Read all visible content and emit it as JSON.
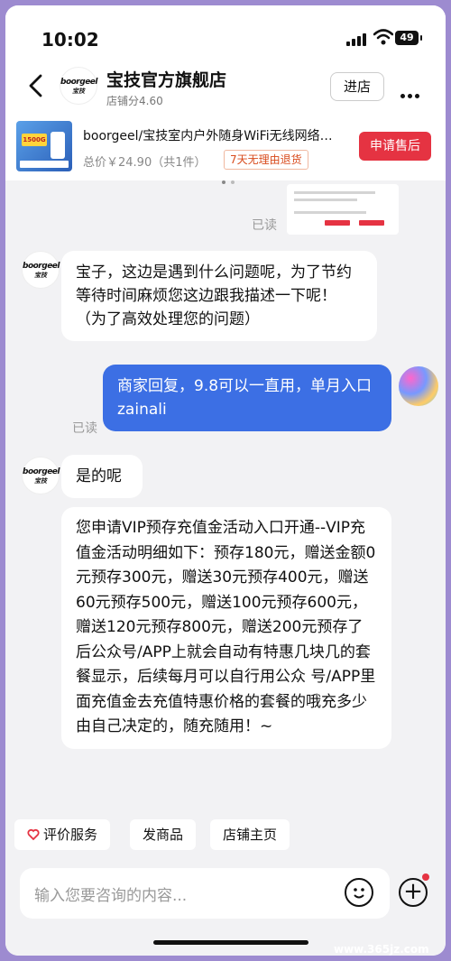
{
  "status": {
    "time": "10:02",
    "battery": "49"
  },
  "header": {
    "store_name": "宝技官方旗舰店",
    "store_score": "店铺分4.60",
    "enter_label": "进店",
    "logo_text": "boorgeel",
    "logo_sub": "宝技"
  },
  "product": {
    "title": "boorgeel/宝技室内户外随身WiFi无线网络…",
    "price": "总价￥24.90（共1件）",
    "tag": "7天无理由退货",
    "aftersale_label": "申请售后",
    "thumb_badge": "1500G"
  },
  "chat": {
    "read_label": "已读",
    "messages": [
      {
        "from": "shop",
        "text": "宝子，这边是遇到什么问题呢，为了节约等待时间麻烦您这边跟我描述一下呢！（为了高效处理您的问题）"
      },
      {
        "from": "me",
        "text": "商家回复，9.8可以一直用，单月入口zainali"
      },
      {
        "from": "shop",
        "text": "是的呢"
      },
      {
        "from": "shop",
        "text": "您申请VIP预存充值金活动入口开通--VIP充值金活动明细如下：预存180元，赠送金额0元预存300元，赠送30元预存400元，赠送60元预存500元，赠送100元预存600元，赠送120元预存800元，赠送200元预存了后公众号/APP上就会自动有特惠几块几的套餐显示，后续每月可以自行用公众 号/APP里面充值金去充值特惠价格的套餐的哦充多少由自己决定的，随充随用！~"
      }
    ]
  },
  "quick_actions": {
    "rate": "评价服务",
    "send_product": "发商品",
    "store_home": "店铺主页"
  },
  "input": {
    "placeholder": "输入您要咨询的内容..."
  },
  "watermark": "www.365jz.com",
  "colors": {
    "accent": "#e53342",
    "my_bubble": "#3c6fe4",
    "background": "#f2f2f4"
  },
  "icons": [
    "back-icon",
    "more-icon",
    "emoji-icon",
    "plus-icon",
    "heart-icon",
    "wifi-icon",
    "signal-icon",
    "battery-icon"
  ]
}
